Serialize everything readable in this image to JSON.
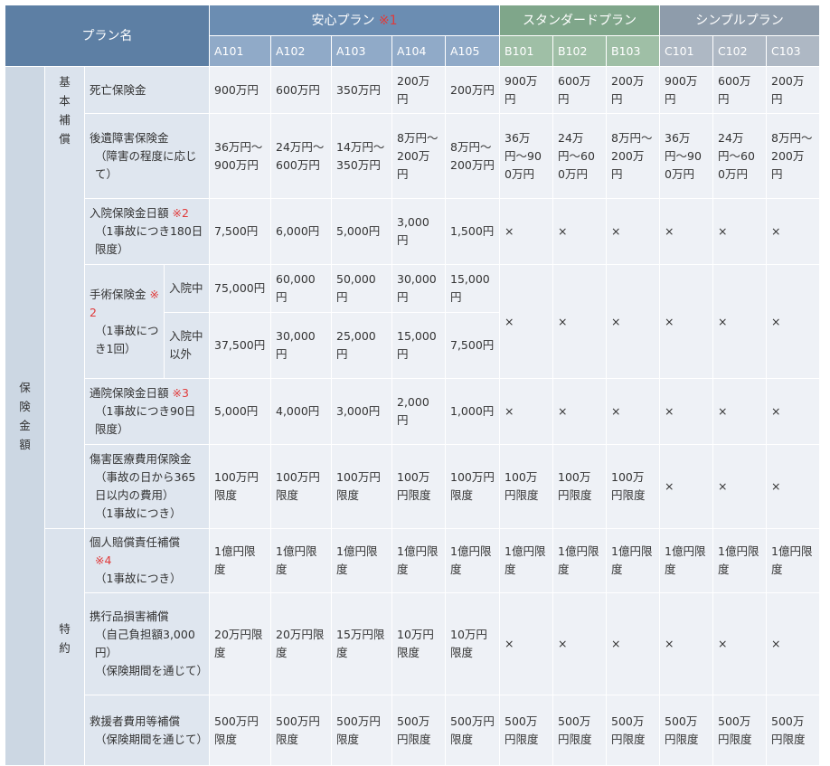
{
  "header": {
    "plan_name": "プラン名",
    "groups": [
      {
        "label": "安心プラン",
        "mark": "※1"
      },
      {
        "label": "スタンダードプラン",
        "mark": ""
      },
      {
        "label": "シンプルプラン",
        "mark": ""
      }
    ],
    "codes": [
      "A101",
      "A102",
      "A103",
      "A104",
      "A105",
      "B101",
      "B102",
      "B103",
      "C101",
      "C102",
      "C103"
    ]
  },
  "categories": {
    "outer": "保険金額",
    "basic": "基本補償",
    "special": "特約"
  },
  "rows": {
    "death": {
      "label": "死亡保険金",
      "values": [
        "900万円",
        "600万円",
        "350万円",
        "200万円",
        "200万円",
        "900万円",
        "600万円",
        "200万円",
        "900万円",
        "600万円",
        "200万円"
      ]
    },
    "disability": {
      "label": "後遺障害保険金",
      "note": "（障害の程度に応じて）",
      "values": [
        "36万円〜900万円",
        "24万円〜600万円",
        "14万円〜350万円",
        "8万円〜200万円",
        "8万円〜200万円",
        "36万円〜900万円",
        "24万円〜600万円",
        "8万円〜200万円",
        "36万円〜900万円",
        "24万円〜600万円",
        "8万円〜200万円"
      ]
    },
    "hospital": {
      "label": "入院保険金日額",
      "mark": "※2",
      "note": "（1事故につき180日限度）",
      "values": [
        "7,500円",
        "6,000円",
        "5,000円",
        "3,000円",
        "1,500円",
        "×",
        "×",
        "×",
        "×",
        "×",
        "×"
      ]
    },
    "surgery": {
      "label": "手術保険金",
      "mark": "※2",
      "note": "（1事故につき1回）",
      "sub_in": "入院中",
      "sub_out": "入院中以外",
      "values_in": [
        "75,000円",
        "60,000円",
        "50,000円",
        "30,000円",
        "15,000円"
      ],
      "values_out": [
        "37,500円",
        "30,000円",
        "25,000円",
        "15,000円",
        "7,500円"
      ],
      "values_other": [
        "×",
        "×",
        "×",
        "×",
        "×",
        "×"
      ]
    },
    "outpatient": {
      "label": "通院保険金日額",
      "mark": "※3",
      "note": "（1事故につき90日限度）",
      "values": [
        "5,000円",
        "4,000円",
        "3,000円",
        "2,000円",
        "1,000円",
        "×",
        "×",
        "×",
        "×",
        "×",
        "×"
      ]
    },
    "medical": {
      "label": "傷害医療費用保険金",
      "note": "（事故の日から365日以内の費用）",
      "note2": "（1事故につき）",
      "values": [
        "100万円限度",
        "100万円限度",
        "100万円限度",
        "100万円限度",
        "100万円限度",
        "100万円限度",
        "100万円限度",
        "100万円限度",
        "×",
        "×",
        "×"
      ]
    },
    "liability": {
      "label": "個人賠償責任補償",
      "mark": "※4",
      "note": "（1事故につき）",
      "values": [
        "1億円限度",
        "1億円限度",
        "1億円限度",
        "1億円限度",
        "1億円限度",
        "1億円限度",
        "1億円限度",
        "1億円限度",
        "1億円限度",
        "1億円限度",
        "1億円限度"
      ]
    },
    "belongings": {
      "label": "携行品損害補償",
      "note": "（自己負担額3,000円）",
      "note2": "（保険期間を通じて）",
      "values": [
        "20万円限度",
        "20万円限度",
        "15万円限度",
        "10万円限度",
        "10万円限度",
        "×",
        "×",
        "×",
        "×",
        "×",
        "×"
      ]
    },
    "rescue": {
      "label": "救援者費用等補償",
      "note": "（保険期間を通じて）",
      "values": [
        "500万円限度",
        "500万円限度",
        "500万円限度",
        "500万円限度",
        "500万円限度",
        "500万円限度",
        "500万円限度",
        "500万円限度",
        "500万円限度",
        "500万円限度",
        "500万円限度"
      ]
    }
  }
}
